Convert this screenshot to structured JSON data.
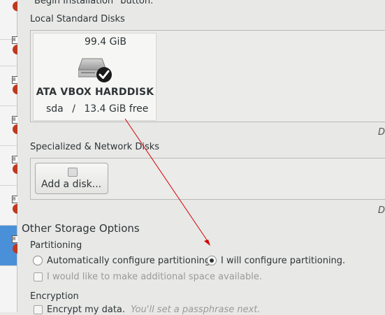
{
  "header_text": "\"Begin Installation\" button.",
  "local_disks": {
    "heading": "Local Standard Disks",
    "disk": {
      "size": "99.4 GiB",
      "name": "ATA VBOX HARDDISK",
      "device": "sda",
      "separator": "/",
      "free": "13.4 GiB free",
      "icon": "harddisk-selected-icon"
    },
    "side_label": "Di"
  },
  "network_disks": {
    "heading": "Specialized & Network Disks",
    "add_button": "Add a disk...",
    "side_label": "Di"
  },
  "other_options": {
    "heading": "Other Storage Options",
    "partitioning": {
      "heading": "Partitioning",
      "auto_label": "Automatically configure partitioning.",
      "manual_label": "I will configure partitioning.",
      "selected": "manual",
      "extra_space_label": "I would like to make additional space available."
    },
    "encryption": {
      "heading": "Encryption",
      "encrypt_label": "Encrypt my data.",
      "encrypt_hint": "You'll set a passphrase next."
    }
  },
  "colors": {
    "accent": "#4a90d9",
    "annotation_arrow": "#d40000",
    "background": "#e8e8e7"
  }
}
